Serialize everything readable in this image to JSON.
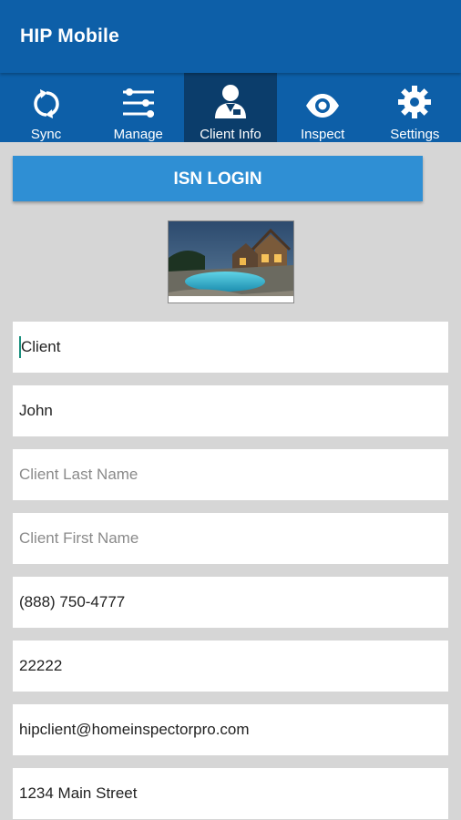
{
  "app": {
    "title": "HIP Mobile"
  },
  "tabs": [
    {
      "label": "Sync",
      "icon": "sync-icon"
    },
    {
      "label": "Manage",
      "icon": "sliders-icon"
    },
    {
      "label": "Client Info",
      "icon": "person-icon",
      "active": true
    },
    {
      "label": "Inspect",
      "icon": "eye-icon"
    },
    {
      "label": "Settings",
      "icon": "gear-icon"
    }
  ],
  "login": {
    "label": "ISN LOGIN"
  },
  "fields": {
    "salutation": "Client",
    "name": "John",
    "last_name_placeholder": "Client Last Name",
    "first_name_placeholder": "Client First Name",
    "phone": "(888) 750-4777",
    "zip": "22222",
    "email": "hipclient@homeinspectorpro.com",
    "address": "1234 Main Street"
  },
  "colors": {
    "primary": "#0d5fa8",
    "active_tab": "#0b3d6b",
    "button": "#2f8fd4",
    "background": "#d6d6d6"
  }
}
